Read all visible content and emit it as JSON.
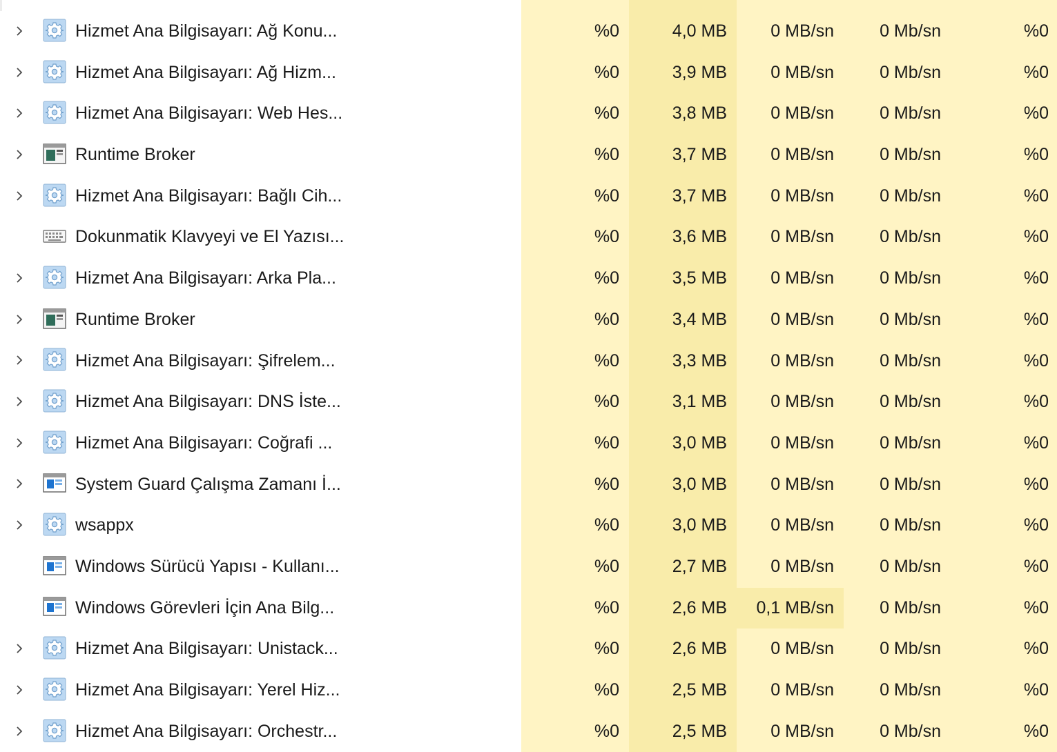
{
  "colors": {
    "cell_bg": "#fff4c4",
    "memory_bg": "#f9ecaa",
    "highlight_bg": "#f9ecaa"
  },
  "processes": [
    {
      "name": "Hizmet Ana Bilgisayarı: Ağ Konu...",
      "icon": "gear-icon",
      "expandable": true,
      "cpu": "%0",
      "memory": "4,0 MB",
      "disk": "0 MB/sn",
      "network": "0 Mb/sn",
      "gpu": "%0"
    },
    {
      "name": "Hizmet Ana Bilgisayarı: Ağ Hizm...",
      "icon": "gear-icon",
      "expandable": true,
      "cpu": "%0",
      "memory": "3,9 MB",
      "disk": "0 MB/sn",
      "network": "0 Mb/sn",
      "gpu": "%0"
    },
    {
      "name": "Hizmet Ana Bilgisayarı: Web Hes...",
      "icon": "gear-icon",
      "expandable": true,
      "cpu": "%0",
      "memory": "3,8 MB",
      "disk": "0 MB/sn",
      "network": "0 Mb/sn",
      "gpu": "%0"
    },
    {
      "name": "Runtime Broker",
      "icon": "app-window-icon",
      "expandable": true,
      "cpu": "%0",
      "memory": "3,7 MB",
      "disk": "0 MB/sn",
      "network": "0 Mb/sn",
      "gpu": "%0"
    },
    {
      "name": "Hizmet Ana Bilgisayarı: Bağlı Cih...",
      "icon": "gear-icon",
      "expandable": true,
      "cpu": "%0",
      "memory": "3,7 MB",
      "disk": "0 MB/sn",
      "network": "0 Mb/sn",
      "gpu": "%0"
    },
    {
      "name": "Dokunmatik Klavyeyi ve El Yazısı...",
      "icon": "keyboard-icon",
      "expandable": false,
      "cpu": "%0",
      "memory": "3,6 MB",
      "disk": "0 MB/sn",
      "network": "0 Mb/sn",
      "gpu": "%0"
    },
    {
      "name": "Hizmet Ana Bilgisayarı: Arka Pla...",
      "icon": "gear-icon",
      "expandable": true,
      "cpu": "%0",
      "memory": "3,5 MB",
      "disk": "0 MB/sn",
      "network": "0 Mb/sn",
      "gpu": "%0"
    },
    {
      "name": "Runtime Broker",
      "icon": "app-window-icon",
      "expandable": true,
      "cpu": "%0",
      "memory": "3,4 MB",
      "disk": "0 MB/sn",
      "network": "0 Mb/sn",
      "gpu": "%0"
    },
    {
      "name": "Hizmet Ana Bilgisayarı: Şifrelem...",
      "icon": "gear-icon",
      "expandable": true,
      "cpu": "%0",
      "memory": "3,3 MB",
      "disk": "0 MB/sn",
      "network": "0 Mb/sn",
      "gpu": "%0"
    },
    {
      "name": "Hizmet Ana Bilgisayarı: DNS İste...",
      "icon": "gear-icon",
      "expandable": true,
      "cpu": "%0",
      "memory": "3,1 MB",
      "disk": "0 MB/sn",
      "network": "0 Mb/sn",
      "gpu": "%0"
    },
    {
      "name": "Hizmet Ana Bilgisayarı: Coğrafi ...",
      "icon": "gear-icon",
      "expandable": true,
      "cpu": "%0",
      "memory": "3,0 MB",
      "disk": "0 MB/sn",
      "network": "0 Mb/sn",
      "gpu": "%0"
    },
    {
      "name": "System Guard Çalışma Zamanı İ...",
      "icon": "window-icon",
      "expandable": true,
      "cpu": "%0",
      "memory": "3,0 MB",
      "disk": "0 MB/sn",
      "network": "0 Mb/sn",
      "gpu": "%0"
    },
    {
      "name": "wsappx",
      "icon": "gear-icon",
      "expandable": true,
      "cpu": "%0",
      "memory": "3,0 MB",
      "disk": "0 MB/sn",
      "network": "0 Mb/sn",
      "gpu": "%0"
    },
    {
      "name": "Windows Sürücü Yapısı - Kullanı...",
      "icon": "window-icon",
      "expandable": false,
      "cpu": "%0",
      "memory": "2,7 MB",
      "disk": "0 MB/sn",
      "network": "0 Mb/sn",
      "gpu": "%0"
    },
    {
      "name": "Windows Görevleri İçin Ana Bilg...",
      "icon": "window-icon",
      "expandable": false,
      "cpu": "%0",
      "memory": "2,6 MB",
      "disk": "0,1 MB/sn",
      "disk_highlight": true,
      "network": "0 Mb/sn",
      "gpu": "%0"
    },
    {
      "name": "Hizmet Ana Bilgisayarı: Unistack...",
      "icon": "gear-icon",
      "expandable": true,
      "cpu": "%0",
      "memory": "2,6 MB",
      "disk": "0 MB/sn",
      "network": "0 Mb/sn",
      "gpu": "%0"
    },
    {
      "name": "Hizmet Ana Bilgisayarı: Yerel Hiz...",
      "icon": "gear-icon",
      "expandable": true,
      "cpu": "%0",
      "memory": "2,5 MB",
      "disk": "0 MB/sn",
      "network": "0 Mb/sn",
      "gpu": "%0"
    },
    {
      "name": "Hizmet Ana Bilgisayarı: Orchestr...",
      "icon": "gear-icon",
      "expandable": true,
      "cpu": "%0",
      "memory": "2,5 MB",
      "disk": "0 MB/sn",
      "network": "0 Mb/sn",
      "gpu": "%0"
    }
  ]
}
